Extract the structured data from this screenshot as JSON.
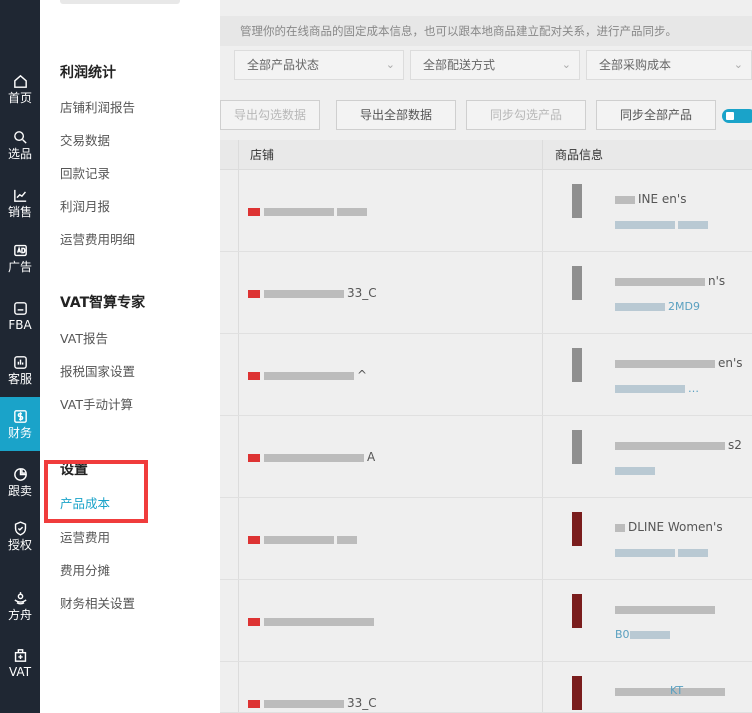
{
  "rail": {
    "items": [
      {
        "label": "首页",
        "icon": "home-icon"
      },
      {
        "label": "选品",
        "icon": "search-icon"
      },
      {
        "label": "销售",
        "icon": "chart-icon"
      },
      {
        "label": "广告",
        "icon": "ad-icon"
      },
      {
        "label": "FBA",
        "icon": "box-icon"
      },
      {
        "label": "客服",
        "icon": "bars-icon"
      },
      {
        "label": "财务",
        "icon": "dollar-icon"
      },
      {
        "label": "跟卖",
        "icon": "pie-icon"
      },
      {
        "label": "授权",
        "icon": "shield-icon"
      },
      {
        "label": "方舟",
        "icon": "ark-icon"
      },
      {
        "label": "VAT",
        "icon": "vat-icon"
      }
    ],
    "active_index": 6,
    "active_color": "#1aa3c9"
  },
  "flyout": {
    "groups": [
      {
        "title": "利润统计",
        "items": [
          "店铺利润报告",
          "交易数据",
          "回款记录",
          "利润月报",
          "运营费用明细"
        ]
      },
      {
        "title": "VAT智算专家",
        "items": [
          "VAT报告",
          "报税国家设置",
          "VAT手动计算"
        ]
      },
      {
        "title": "设置",
        "items": [
          "产品成本",
          "运营费用",
          "费用分摊",
          "财务相关设置"
        ]
      }
    ],
    "active_item": "产品成本",
    "highlight_color": "#f03c3c"
  },
  "background_page": {
    "notice": "管理你的在线商品的固定成本信息，也可以跟本地商品建立配对关系，进行产品同步。",
    "filters": [
      "全部产品状态",
      "全部配送方式",
      "全部采购成本"
    ],
    "buttons": [
      "导出勾选数据",
      "导出全部数据",
      "同步勾选产品",
      "同步全部产品"
    ],
    "columns": [
      "店铺",
      "商品信息"
    ],
    "rows": [
      {
        "shop": "",
        "product": "INE  en's"
      },
      {
        "shop": "33_C",
        "product": "n's",
        "sku": "2MD9"
      },
      {
        "shop": "^",
        "product": "en's",
        "sku": "…"
      },
      {
        "shop": "A",
        "product": "s2"
      },
      {
        "shop": "",
        "product": "DLINE Women's"
      },
      {
        "shop": "",
        "product": "",
        "sku": "B0"
      },
      {
        "shop": "33_C",
        "product": "",
        "sku": "KT"
      }
    ]
  }
}
